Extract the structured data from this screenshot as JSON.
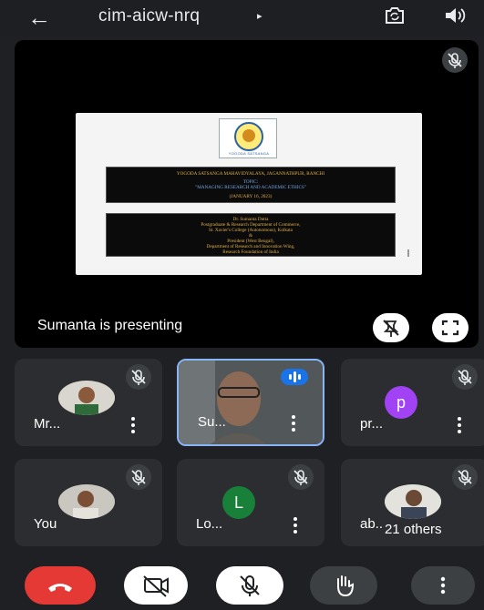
{
  "header": {
    "title": "cim-aicw-nrq",
    "caret": "▸",
    "back_icon": "arrow-left-icon",
    "flip_camera_icon": "flip-camera-icon",
    "speaker_icon": "speaker-icon"
  },
  "presentation": {
    "presenting_label": "Sumanta is presenting",
    "slide": {
      "logo_text": "YOGODA SATSANGA",
      "logo_subtext": "EDUCATIONAL INSTITUTIONS",
      "line1": "YOGODA SATSANGA MAHAVIDYALAYA, JAGANNATHPUR, RANCHI",
      "line2": "TOPIC:",
      "line3": "\"MANAGING RESEARCH AND ACADEMIC ETHICS\"",
      "line4": "(JANUARY 16, 2023)",
      "line5": "Dr. Sumanta Dutta",
      "line6": "Postgraduate & Research Department of Commerce,",
      "line7": "St. Xavier's College (Autonomous), Kolkata",
      "line8": "&",
      "line9": "President (West Bengal),",
      "line10": "Department of Research and Innovation Wing,",
      "line11": "Research Foundation of India"
    },
    "pin_icon": "unpin-icon",
    "fullscreen_icon": "fullscreen-icon"
  },
  "participants": [
    {
      "name": "Mr...",
      "type": "photo",
      "muted": true
    },
    {
      "name": "Su...",
      "type": "video",
      "speaking": true
    },
    {
      "name": "pr...",
      "type": "letter",
      "letter": "p",
      "color": "#a142f4",
      "muted": true
    },
    {
      "name": "You",
      "type": "photo",
      "muted": true
    },
    {
      "name": "Lo...",
      "type": "letter",
      "letter": "L",
      "color": "#188038",
      "muted": true
    },
    {
      "name": "ab...",
      "type": "photo",
      "muted": true
    }
  ],
  "others_label": "21 others",
  "controls": {
    "leave": "end-call-icon",
    "camera": "camera-off-icon",
    "mic": "mic-off-icon",
    "hand": "raise-hand-icon",
    "more": "more-vert-icon"
  },
  "colors": {
    "background": "#1f2023",
    "tile": "#2c2d31",
    "leave_red": "#e53935",
    "active_blue": "#8ab4f8",
    "speaking_badge": "#1a73e8"
  }
}
